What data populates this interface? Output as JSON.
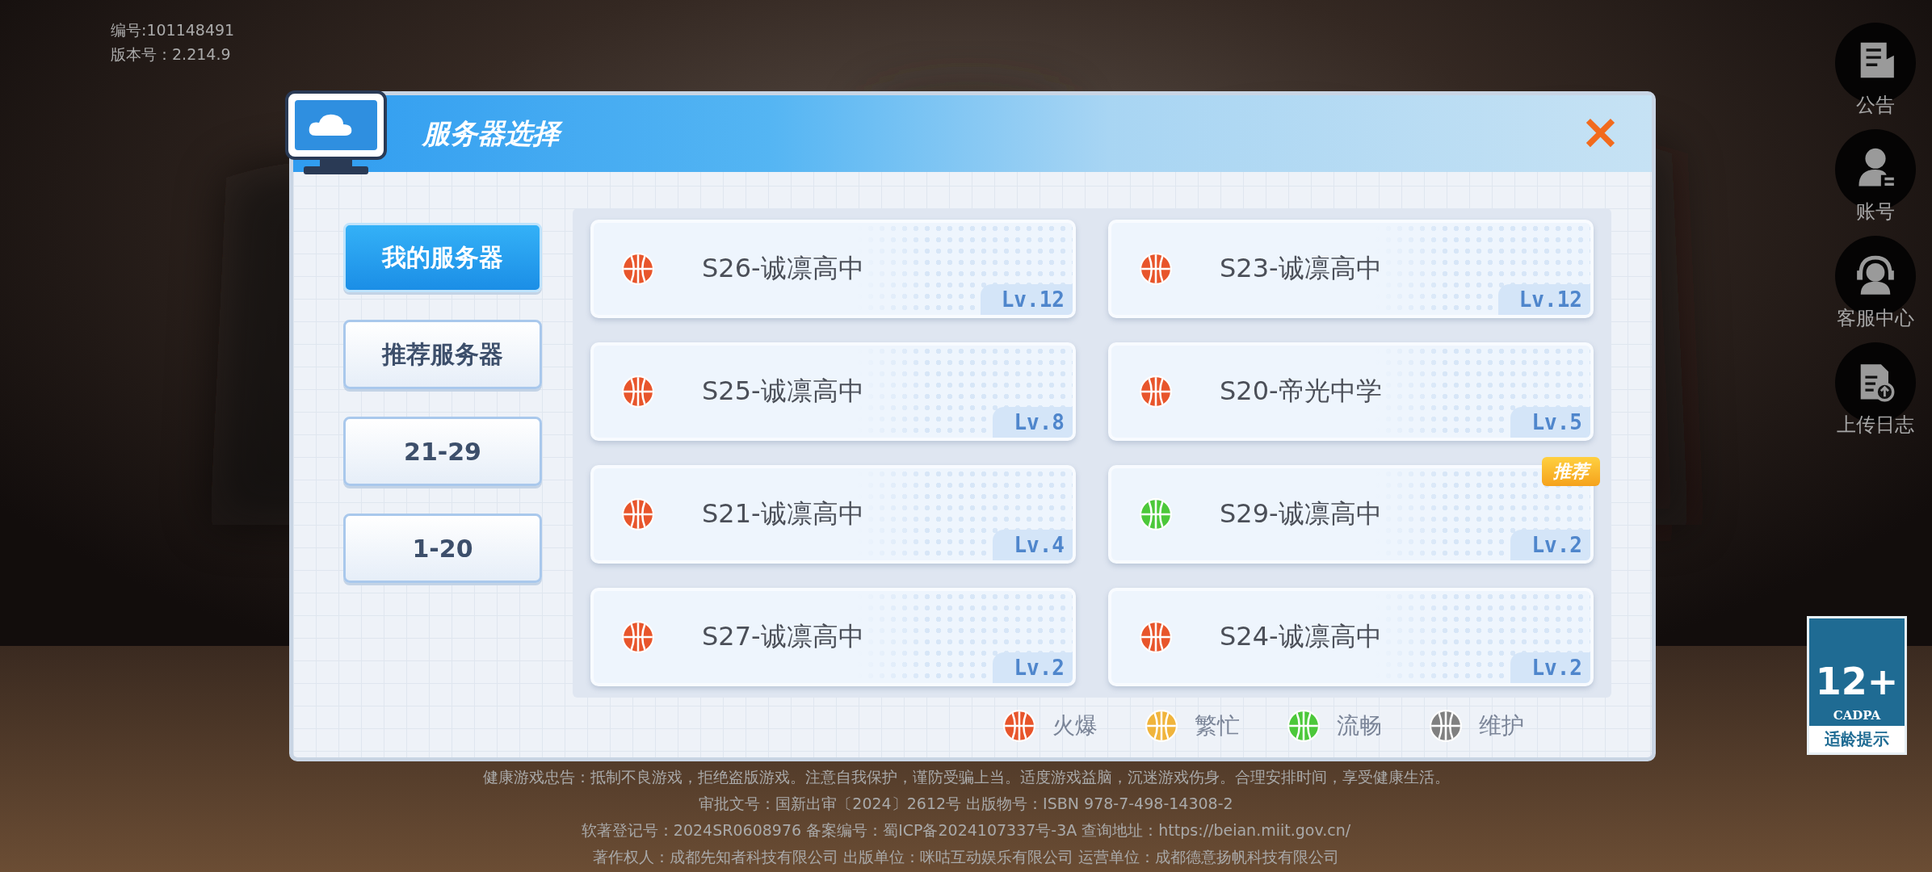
{
  "build_info": {
    "id_line": "编号:101148491",
    "version_line": "版本号：2.214.9"
  },
  "dialog": {
    "title": "服务器选择",
    "close": "✕"
  },
  "tabs": [
    {
      "label": "我的服务器",
      "selected": true
    },
    {
      "label": "推荐服务器",
      "selected": false
    },
    {
      "label": "21-29",
      "selected": false
    },
    {
      "label": "1-20",
      "selected": false
    }
  ],
  "servers": [
    {
      "name": "S26-诚凛高中",
      "level": "Lv.12",
      "color": "#e8552b",
      "recommended": false
    },
    {
      "name": "S23-诚凛高中",
      "level": "Lv.12",
      "color": "#e8552b",
      "recommended": false
    },
    {
      "name": "S25-诚凛高中",
      "level": "Lv.8",
      "color": "#e8552b",
      "recommended": false
    },
    {
      "name": "S20-帝光中学",
      "level": "Lv.5",
      "color": "#e8552b",
      "recommended": false
    },
    {
      "name": "S21-诚凛高中",
      "level": "Lv.4",
      "color": "#e8552b",
      "recommended": false
    },
    {
      "name": "S29-诚凛高中",
      "level": "Lv.2",
      "color": "#4cc83a",
      "recommended": true
    },
    {
      "name": "S27-诚凛高中",
      "level": "Lv.2",
      "color": "#e8552b",
      "recommended": false
    },
    {
      "name": "S24-诚凛高中",
      "level": "Lv.2",
      "color": "#e8552b",
      "recommended": false
    }
  ],
  "recommended_tag": {
    "label": "推荐"
  },
  "legend": [
    {
      "label": "火爆",
      "color": "#e8552b"
    },
    {
      "label": "繁忙",
      "color": "#f0b43c"
    },
    {
      "label": "流畅",
      "color": "#4cc83a"
    },
    {
      "label": "维护",
      "color": "#808080"
    }
  ],
  "side_menu": [
    {
      "label": "公告",
      "kind": "notice"
    },
    {
      "label": "账号",
      "kind": "account"
    },
    {
      "label": "客服中心",
      "kind": "support"
    },
    {
      "label": "上传日志",
      "kind": "upload"
    }
  ],
  "age_rating": {
    "value": "12+",
    "org": "CADPA",
    "caption": "适龄提示"
  },
  "footer": [
    "健康游戏忠告：抵制不良游戏，拒绝盗版游戏。注意自我保护，谨防受骗上当。适度游戏益脑，沉迷游戏伤身。合理安排时间，享受健康生活。",
    "审批文号：国新出审〔2024〕2612号 出版物号：ISBN 978-7-498-14308-2",
    "软著登记号：2024SR0608976 备案编号：蜀ICP备2024107337号-3A 查询地址：https://beian.miit.gov.cn/",
    "著作权人：成都先知者科技有限公司 出版单位：咪咕互动娱乐有限公司 运营单位：成都德意扬帆科技有限公司"
  ]
}
